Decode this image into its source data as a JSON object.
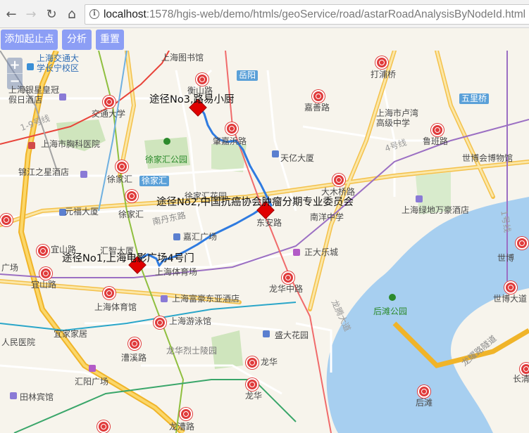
{
  "browser": {
    "back_icon": "←",
    "forward_icon": "→",
    "reload_icon": "↻",
    "home_icon": "⌂",
    "url_host": "localhost",
    "url_rest": ":1578/hgis-web/demo/htmls/geoService/road/astarRoadAnalysisByNodeId.html"
  },
  "toolbar": {
    "add_points_label": "添加起止点",
    "analyze_label": "分析",
    "reset_label": "重置"
  },
  "map": {
    "zoom_in": "+",
    "zoom_out": "−",
    "route_color": "#2f7be0",
    "markers": [
      "途径No1,上海电影广场4号门",
      "途径No2,中国抗癌协会肿瘤分期专业委员会",
      "途径No3,路易小厨"
    ],
    "labels": {
      "l01": "上海交通大学长宁校区",
      "l02": "上海图书馆",
      "l03": "衡山路",
      "l04": "岳阳",
      "l05": "打浦桥",
      "l06": "五里桥",
      "l07": "上海银星皇冠假日酒店",
      "l08": "交通大学",
      "l09": "嘉善路",
      "l10": "上海市卢湾高级中学",
      "l11": "上海市胸科医院",
      "l12": "肇嘉浜路",
      "l13": "鲁班路",
      "l14": "徐家汇公园",
      "l15": "天亿大厦",
      "l16": "世博会博物馆",
      "l17": "锦江之星酒店",
      "l18": "徐家汇",
      "l19": "徐家汇",
      "l20": "大木桥路",
      "l21": "徐家汇花园",
      "l22": "元福大厦",
      "l23": "徐家汇",
      "l24": "南丹东路",
      "l25": "上海绿地万豪酒店",
      "l26": "南洋中学",
      "l27": "东安路",
      "l28": "嘉汇广场",
      "l29": "宜山路",
      "l30": "汇智大厦",
      "l31": "正大乐城",
      "l32": "世博",
      "l33": "上海体育场",
      "l34": "宜山路",
      "l35": "龙华中路",
      "l36": "上海富豪东亚酒店",
      "l37": "世博大道",
      "l38": "上海体育馆",
      "l39": "后滩公园",
      "l40": "宜家家居",
      "l41": "上海游泳馆",
      "l42": "盛大花园",
      "l43": "龙华烈士陵园",
      "l44": "漕溪路",
      "l45": "龙华",
      "l46": "汇阳广场",
      "l47": "龙华",
      "l48": "田林宾馆",
      "l49": "后滩",
      "l50": "长清",
      "l51": "龙漕路",
      "l52": "广场",
      "l53": "人民医院",
      "l54": "1-9号线",
      "l55": "4号线",
      "l56": "龙腾大道",
      "l57": "龙耀路隧道",
      "l58": "1号线"
    }
  }
}
